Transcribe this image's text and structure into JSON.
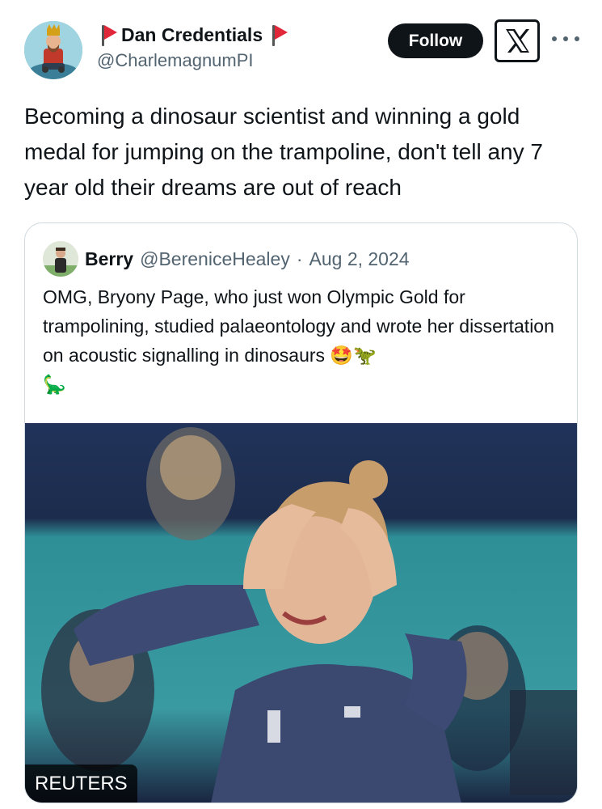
{
  "author": {
    "display_name": "Dan Credentials",
    "handle": "@CharlemagnumPI",
    "flag_icon": "red-flag-icon"
  },
  "actions": {
    "follow_label": "Follow"
  },
  "tweet": {
    "text": "Becoming a dinosaur scientist and winning a gold medal for jumping on the trampoline, don't tell any 7 year old their dreams are out of reach"
  },
  "quoted": {
    "name": "Berry",
    "handle": "@BereniceHealey",
    "separator": "·",
    "date": "Aug 2, 2024",
    "text": "OMG, Bryony Page, who just won Olympic Gold for trampolining, studied palaeontology and wrote her dissertation on acoustic signalling in dinosaurs 🤩🦖",
    "text_line2": "🦕",
    "media_credit": "REUTERS"
  },
  "colors": {
    "primary_text": "#0f1419",
    "secondary_text": "#536471",
    "border": "#cfd9de",
    "flag": "#e0283a"
  }
}
